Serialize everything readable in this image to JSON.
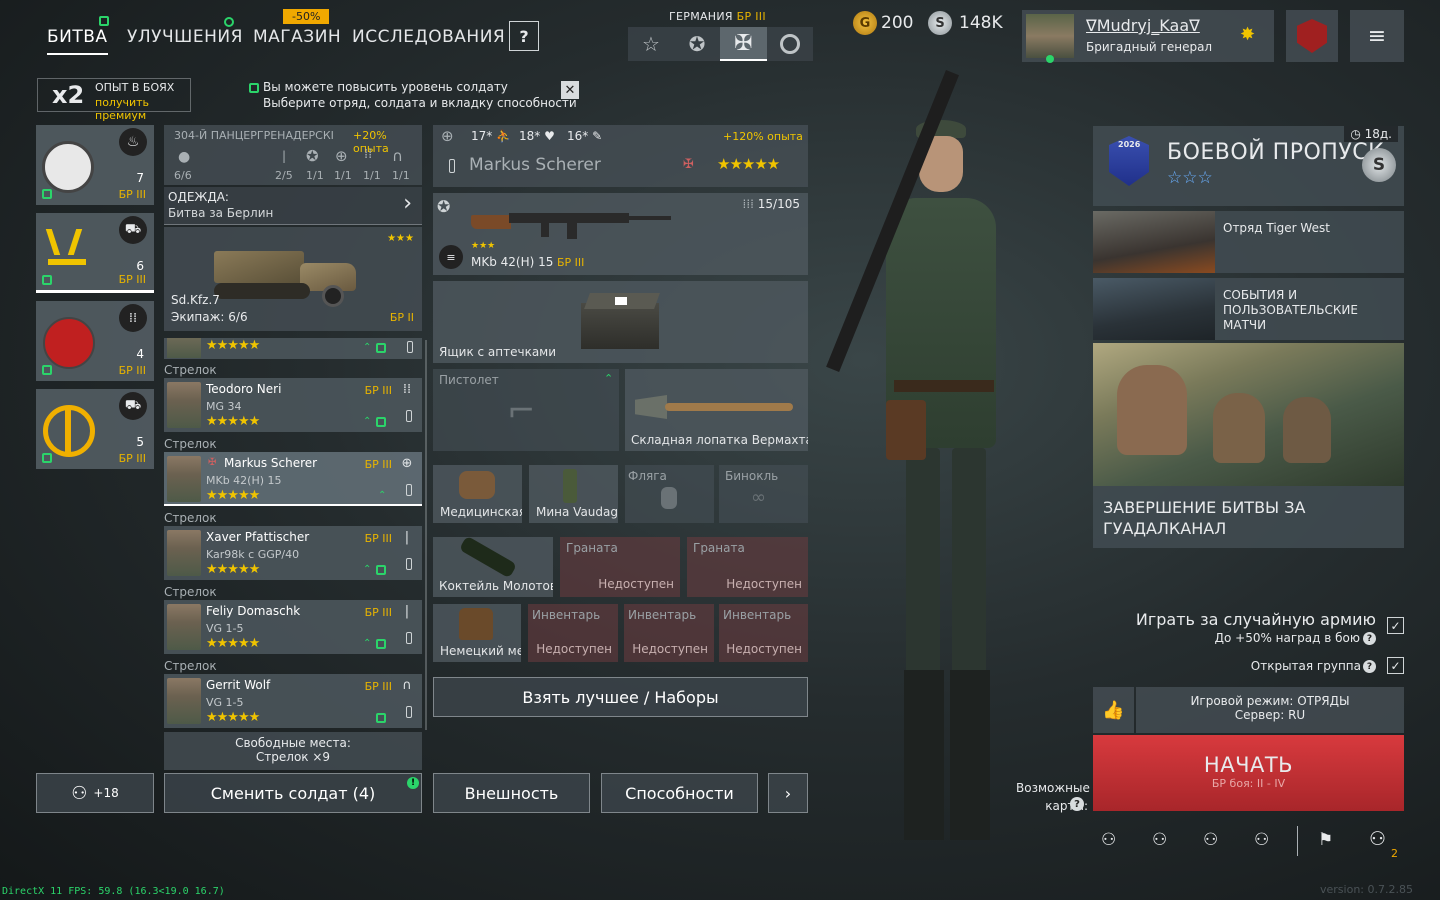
{
  "nav": {
    "tabs": [
      "БИТВА",
      "УЛУЧШЕНИЯ",
      "МАГАЗИН",
      "ИССЛЕДОВАНИЯ"
    ],
    "sale_badge": "-50%",
    "help": "?"
  },
  "faction": {
    "name": "ГЕРМАНИЯ",
    "br": "БР III"
  },
  "currency": {
    "gold": "200",
    "silver": "148K"
  },
  "profile": {
    "name": "∇Mudryj_Kaa∇",
    "rank": "Бригадный генерал"
  },
  "exp_boost": {
    "mult": "x2",
    "title": "ОПЫТ В БОЯХ",
    "link": "получить премиум"
  },
  "notice": {
    "line1": "Вы можете повысить уровень солдату",
    "line2": "Выберите отряд, солдата и вкладку способности"
  },
  "squads": [
    {
      "count": "7",
      "br": "БР III"
    },
    {
      "count": "6",
      "br": "БР III"
    },
    {
      "count": "4",
      "br": "БР III"
    },
    {
      "count": "5",
      "br": "БР III"
    }
  ],
  "squad_header": {
    "name": "304-Й ПАНЦЕРГРЕНАДЕРСКІ",
    "bonus": "+20% опыта",
    "size": "6/6",
    "class_counts": [
      "2/5",
      "1/1",
      "1/1",
      "1/1",
      "1/1"
    ]
  },
  "clothing": {
    "title": "ОДЕЖДА:",
    "value": "Битва за Берлин"
  },
  "vehicle": {
    "name": "Sd.Kfz.7",
    "crew": "Экипаж: 6/6",
    "br": "БР II",
    "stars": "★★★"
  },
  "soldiers": [
    {
      "class": "Стрелок",
      "name": "Teodoro Neri",
      "weapon": "MG 34",
      "br": "БР III",
      "stars": "★★★★★"
    },
    {
      "class": "Стрелок",
      "name": "Markus Scherer",
      "weapon": "MKb 42(H) 15",
      "br": "БР III",
      "stars": "★★★★★"
    },
    {
      "class": "Стрелок",
      "name": "Xaver Pfattischer",
      "weapon": "Kar98k с GGP/40",
      "br": "БР III",
      "stars": "★★★★★"
    },
    {
      "class": "Стрелок",
      "name": "Feliy Domaschk",
      "weapon": "VG 1-5",
      "br": "БР III",
      "stars": "★★★★★"
    },
    {
      "class": "Стрелок",
      "name": "Gerrit Wolf",
      "weapon": "VG 1-5",
      "br": "БР III",
      "stars": "★★★★★"
    }
  ],
  "first_row_stars": "★★★★★",
  "free_slots": {
    "title": "Свободные места:",
    "value": "Стрелок ×9"
  },
  "soldier_detail": {
    "stat1": "17",
    "stat2": "18",
    "stat3": "16",
    "exp_bonus": "+120% опыта",
    "name": "Markus Scherer",
    "stars": "★★★★★"
  },
  "primary_weapon": {
    "name": "MKb 42(H) 15",
    "br": "БР III",
    "ammo": "15/105",
    "stars": "★★★"
  },
  "slots": {
    "medkit_box": "Ящик с аптечками",
    "pistol": "Пистолет",
    "shovel": "Складная лопатка Вермахта",
    "medbag": "Медицинская",
    "mine": "Мина Vaudag",
    "flask": "Фляга",
    "binoculars": "Бинокль",
    "molotov": "Коктейль Молотова",
    "grenade1": "Граната",
    "grenade2": "Граната",
    "backpack": "Немецкий ме",
    "inv1": "Инвентарь",
    "inv2": "Инвентарь",
    "inv3": "Инвентарь",
    "unavailable": "Недоступен"
  },
  "best_kit_button": "Взять лучшее / Наборы",
  "bottom": {
    "squad_count": "+18",
    "change_soldiers": "Сменить солдат (4)",
    "appearance": "Внешность",
    "abilities": "Способности",
    "maps_label": "Возможные карты:"
  },
  "battlepass": {
    "title": "БОЕВОЙ ПРОПУСК",
    "timer": "18д.",
    "year": "2026",
    "stars": "☆☆☆"
  },
  "news": [
    "Отряд Tiger West",
    "СОБЫТИЯ И ПОЛЬЗОВАТЕЛЬСКИЕ МАТЧИ"
  ],
  "event_banner": {
    "title": "ЗАВЕРШЕНИЕ БИТВЫ ЗА ГУАДАЛКАНАЛ"
  },
  "random_army": {
    "label": "Играть за случайную армию",
    "sub": "До +50% наград в бою"
  },
  "open_group": "Открытая группа",
  "game_mode": {
    "mode": "Игровой режим: ОТРЯДЫ",
    "server": "Сервер: RU"
  },
  "start": {
    "label": "НАЧАТЬ",
    "sub": "БР боя: II - IV"
  },
  "group_count": "2",
  "debug": "DirectX 11 FPS: 59.8 (16.3<19.0 16.7)",
  "version": "version: 0.7.2.85"
}
